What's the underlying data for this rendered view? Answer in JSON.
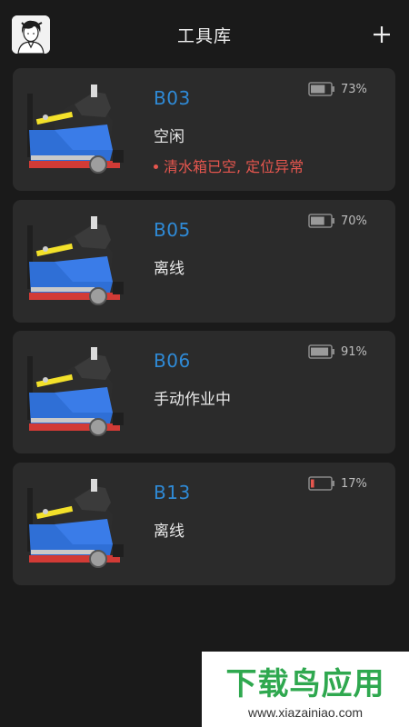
{
  "header": {
    "title": "工具库",
    "avatar_icon": "user-avatar-icon",
    "add_icon": "plus-icon"
  },
  "devices": [
    {
      "code": "B03",
      "status": "空闲",
      "alert": "清水箱已空, 定位异常",
      "battery_pct": "73%",
      "battery_level": 0.73,
      "battery_color": "#9a9a9a"
    },
    {
      "code": "B05",
      "status": "离线",
      "alert": "",
      "battery_pct": "70%",
      "battery_level": 0.7,
      "battery_color": "#9a9a9a"
    },
    {
      "code": "B06",
      "status": "手动作业中",
      "alert": "",
      "battery_pct": "91%",
      "battery_level": 0.91,
      "battery_color": "#9a9a9a"
    },
    {
      "code": "B13",
      "status": "离线",
      "alert": "",
      "battery_pct": "17%",
      "battery_level": 0.17,
      "battery_color": "#e5564e"
    }
  ],
  "colors": {
    "background": "#1a1a1a",
    "card": "#2b2b2b",
    "code": "#2f8ad6",
    "alert": "#e5564e"
  },
  "watermark": {
    "brand": "下载鸟应用",
    "url": "www.xiazainiao.com"
  }
}
